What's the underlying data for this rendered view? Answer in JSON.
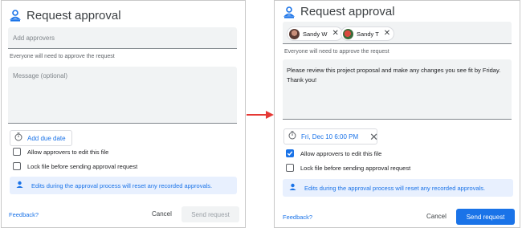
{
  "colors": {
    "accent": "#1a73e8",
    "arrow": "#e53935",
    "banner_bg": "#e8f0fe",
    "field_bg": "#f1f3f4"
  },
  "icons": {
    "header": "approval-person-icon",
    "due": "timer-icon",
    "info": "person-info-icon",
    "remove": "close-icon",
    "arrow": "right-arrow-icon"
  },
  "left": {
    "title": "Request approval",
    "approvers_placeholder": "Add approvers",
    "approve_hint": "Everyone will need to approve the request",
    "message_placeholder": "Message (optional)",
    "due_label": "Add due date",
    "option_edit": "Allow approvers to edit this file",
    "option_edit_checked": false,
    "option_lock": "Lock file before sending approval request",
    "option_lock_checked": false,
    "info_text": "Edits during the approval process will reset any recorded approvals.",
    "feedback": "Feedback?",
    "cancel": "Cancel",
    "send": "Send request"
  },
  "right": {
    "title": "Request approval",
    "approvers": [
      {
        "name": "Sandy W",
        "remove": "✕"
      },
      {
        "name": "Sandy T",
        "remove": "✕"
      }
    ],
    "approve_hint": "Everyone will need to approve the request",
    "message": "Please review this project proposal and make any changes you see fit by Friday. Thank you!",
    "due_label": "Fri, Dec 10 6:00 PM",
    "due_remove": "✕",
    "option_edit": "Allow approvers to edit this file",
    "option_edit_checked": true,
    "option_lock": "Lock file before sending approval request",
    "option_lock_checked": false,
    "info_text": "Edits during the approval process will reset any recorded approvals.",
    "feedback": "Feedback?",
    "cancel": "Cancel",
    "send": "Send request"
  }
}
